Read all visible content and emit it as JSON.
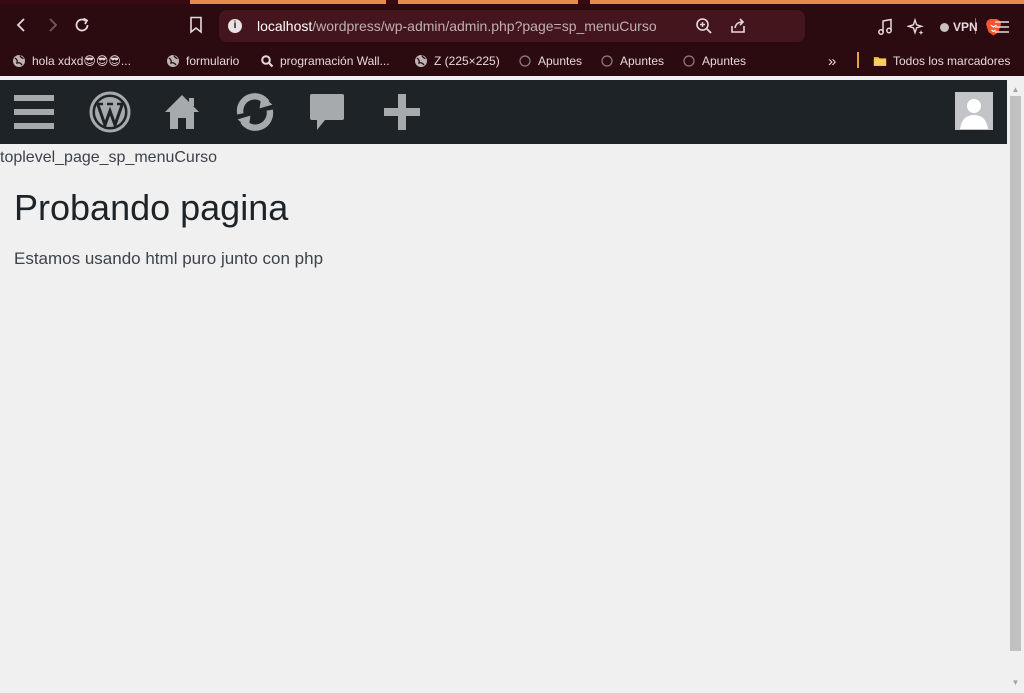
{
  "browser": {
    "url": {
      "host": "localhost",
      "path": "/wordpress/wp-admin/admin.php?page=sp_menuCurso"
    },
    "vpn_label": "VPN",
    "icons": {
      "back": "arrow-left-icon",
      "forward": "arrow-right-icon",
      "reload": "reload-icon",
      "bookmark": "bookmark-icon",
      "site_info": "info-icon",
      "zoom": "zoom-icon",
      "share": "share-icon",
      "shields": "brave-lion-icon",
      "media": "music-icon",
      "leo": "sparkle-icon",
      "menu": "hamburger-icon"
    },
    "colors": {
      "toolbar_bg": "#2b0a10",
      "urlbar_bg": "#45151d",
      "tab_accent": "#e58a4b",
      "brave_orange": "#fb542b"
    }
  },
  "bookmarks": {
    "items": [
      {
        "label": "hola xdxd😎😎😎...",
        "icon": "globe-icon"
      },
      {
        "label": "formulario",
        "icon": "globe-icon"
      },
      {
        "label": "programación Wall...",
        "icon": "search-icon"
      },
      {
        "label": "Z (225×225)",
        "icon": "globe-icon"
      },
      {
        "label": "Apuntes",
        "icon": "loading-icon"
      },
      {
        "label": "Apuntes",
        "icon": "loading-icon"
      },
      {
        "label": "Apuntes",
        "icon": "loading-icon"
      }
    ],
    "overflow": "»",
    "all_bookmarks": "Todos los marcadores"
  },
  "adminbar": {
    "items": [
      "menu-toggle-icon",
      "wordpress-logo-icon",
      "home-icon",
      "updates-icon",
      "comments-icon",
      "new-content-icon"
    ],
    "bg": "#1d2327",
    "icon_color": "#a7aaad"
  },
  "content": {
    "hook_name": "toplevel_page_sp_menuCurso",
    "title": "Probando pagina",
    "paragraph": "Estamos usando html puro junto con php"
  }
}
